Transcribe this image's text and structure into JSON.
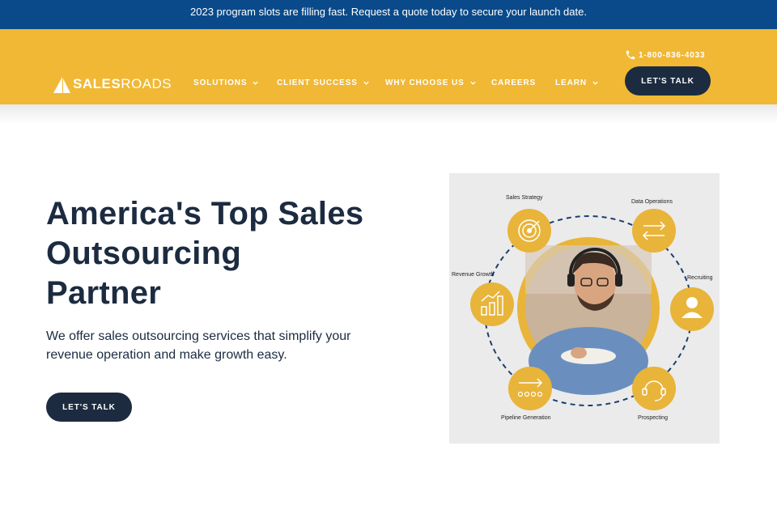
{
  "announcement": {
    "text": "2023 program slots are filling fast. Request a quote today to secure your launch date."
  },
  "header": {
    "logo": {
      "bold": "SALES",
      "light": "ROADS"
    },
    "phone": "1-800-836-4033",
    "cta_label": "LET'S TALK",
    "nav": [
      {
        "label": "SOLUTIONS",
        "has_dropdown": true
      },
      {
        "label": "CLIENT SUCCESS",
        "has_dropdown": true
      },
      {
        "label": "WHY CHOOSE US",
        "has_dropdown": true
      },
      {
        "label": "CAREERS",
        "has_dropdown": false
      },
      {
        "label": "LEARN",
        "has_dropdown": true
      }
    ]
  },
  "hero": {
    "title_lines": [
      "America's Top Sales",
      "Outsourcing",
      "Partner"
    ],
    "subtitle": "We offer sales outsourcing services that simplify your revenue operation and make growth easy.",
    "cta_label": "LET'S TALK"
  },
  "graphic": {
    "labels": {
      "sales_strategy": "Sales Strategy",
      "data_operations": "Data Operations",
      "recruiting": "Recruiting",
      "revenue_growth": "Revenue Growth",
      "pipeline_generation": "Pipeline Generation",
      "prospecting": "Prospecting"
    }
  },
  "colors": {
    "announcement_bg": "#0a4a8a",
    "header_bg": "#f0b834",
    "navy": "#1c2b40",
    "gold": "#e8b43a",
    "graphic_bg": "#ebebeb"
  },
  "icons": [
    "phone-icon",
    "chevron-down-icon",
    "target-icon",
    "arrows-icon",
    "user-icon",
    "bar-chart-icon",
    "pipeline-icon",
    "headset-icon"
  ]
}
